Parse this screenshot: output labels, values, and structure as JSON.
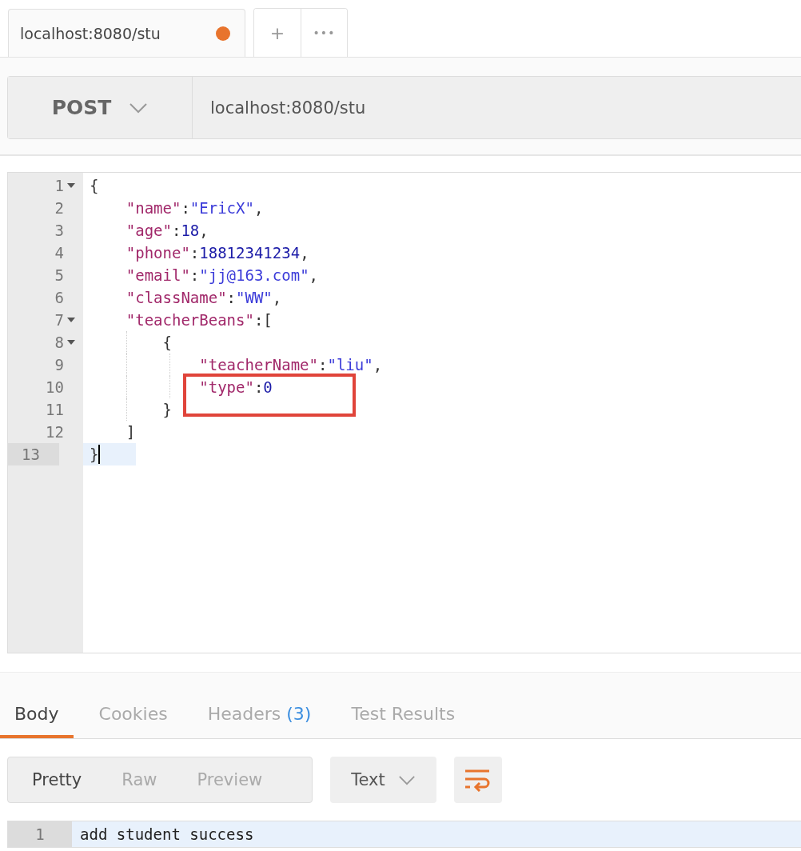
{
  "request_tabs": [
    {
      "label": "localhost:8080/stu",
      "unsaved": true,
      "selected": true
    }
  ],
  "tab_actions": [
    {
      "kind": "add",
      "label": "+"
    },
    {
      "kind": "more",
      "label": "•••"
    }
  ],
  "request": {
    "method": "POST",
    "url": "localhost:8080/stu"
  },
  "body_editor": {
    "lines": [
      {
        "number": "1",
        "fold": true,
        "active": false,
        "boxed": false,
        "tokens": [
          {
            "kind": "punct",
            "text": "{"
          }
        ]
      },
      {
        "number": "2",
        "fold": false,
        "active": false,
        "boxed": false,
        "tokens": [
          {
            "kind": "key",
            "text": "    \"name\""
          },
          {
            "kind": "punct",
            "text": ":"
          },
          {
            "kind": "string",
            "text": "\"EricX\""
          },
          {
            "kind": "punct",
            "text": ","
          }
        ]
      },
      {
        "number": "3",
        "fold": false,
        "active": false,
        "boxed": false,
        "tokens": [
          {
            "kind": "key",
            "text": "    \"age\""
          },
          {
            "kind": "punct",
            "text": ":"
          },
          {
            "kind": "number",
            "text": "18"
          },
          {
            "kind": "punct",
            "text": ","
          }
        ]
      },
      {
        "number": "4",
        "fold": false,
        "active": false,
        "boxed": false,
        "tokens": [
          {
            "kind": "key",
            "text": "    \"phone\""
          },
          {
            "kind": "punct",
            "text": ":"
          },
          {
            "kind": "number",
            "text": "18812341234"
          },
          {
            "kind": "punct",
            "text": ","
          }
        ]
      },
      {
        "number": "5",
        "fold": false,
        "active": false,
        "boxed": false,
        "tokens": [
          {
            "kind": "key",
            "text": "    \"email\""
          },
          {
            "kind": "punct",
            "text": ":"
          },
          {
            "kind": "string",
            "text": "\"jj@163.com\""
          },
          {
            "kind": "punct",
            "text": ","
          }
        ]
      },
      {
        "number": "6",
        "fold": false,
        "active": false,
        "boxed": false,
        "tokens": [
          {
            "kind": "key",
            "text": "    \"className\""
          },
          {
            "kind": "punct",
            "text": ":"
          },
          {
            "kind": "string",
            "text": "\"WW\""
          },
          {
            "kind": "punct",
            "text": ","
          }
        ]
      },
      {
        "number": "7",
        "fold": true,
        "active": false,
        "boxed": false,
        "tokens": [
          {
            "kind": "key",
            "text": "    \"teacherBeans\""
          },
          {
            "kind": "punct",
            "text": ":["
          }
        ]
      },
      {
        "number": "8",
        "fold": true,
        "active": false,
        "boxed": false,
        "tokens": [
          {
            "kind": "punct",
            "text": "        {"
          }
        ]
      },
      {
        "number": "9",
        "fold": false,
        "active": false,
        "boxed": false,
        "tokens": [
          {
            "kind": "key",
            "text": "            \"teacherName\""
          },
          {
            "kind": "punct",
            "text": ":"
          },
          {
            "kind": "string",
            "text": "\"liu\""
          },
          {
            "kind": "punct",
            "text": ","
          }
        ]
      },
      {
        "number": "10",
        "fold": false,
        "active": false,
        "boxed": true,
        "tokens": [
          {
            "kind": "key",
            "text": "            \"type\""
          },
          {
            "kind": "punct",
            "text": ":"
          },
          {
            "kind": "number",
            "text": "0"
          }
        ]
      },
      {
        "number": "11",
        "fold": false,
        "active": false,
        "boxed": false,
        "tokens": [
          {
            "kind": "punct",
            "text": "        }"
          }
        ]
      },
      {
        "number": "12",
        "fold": false,
        "active": false,
        "boxed": false,
        "tokens": [
          {
            "kind": "punct",
            "text": "    ]"
          }
        ]
      },
      {
        "number": "13",
        "fold": false,
        "active": true,
        "boxed": false,
        "tokens": [
          {
            "kind": "punct",
            "text": "}"
          }
        ]
      }
    ]
  },
  "response_tabs": [
    {
      "label": "Body",
      "selected": true
    },
    {
      "label": "Cookies",
      "selected": false
    },
    {
      "label": "Headers",
      "count": "(3)",
      "selected": false
    },
    {
      "label": "Test Results",
      "selected": false
    }
  ],
  "view_modes": [
    {
      "label": "Pretty",
      "selected": true
    },
    {
      "label": "Raw",
      "selected": false
    },
    {
      "label": "Preview",
      "selected": false
    }
  ],
  "format": {
    "label": "Text"
  },
  "response_lines": [
    {
      "number": "1",
      "text": "add student success"
    }
  ]
}
